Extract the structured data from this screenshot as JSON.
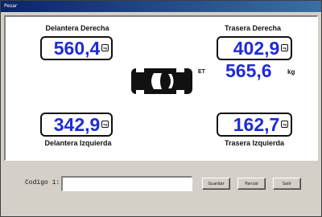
{
  "window": {
    "title": "Pesar"
  },
  "wheels": {
    "front_right": {
      "label": "Delantera Derecha",
      "value": "560,4",
      "unit": "kg"
    },
    "rear_right": {
      "label": "Trasera Derecha",
      "value": "402,9",
      "unit": "kg"
    },
    "front_left": {
      "label": "Delantera Izquierda",
      "value": "342,9",
      "unit": "kg"
    },
    "rear_left": {
      "label": "Trasera Izquierda",
      "value": "162,7",
      "unit": "kg"
    }
  },
  "total": {
    "label": "ET",
    "value": "565,6",
    "unit": "kg"
  },
  "form": {
    "code_label": "Codigo 1:",
    "code_value": ""
  },
  "buttons": {
    "save": "Guardar",
    "partial": "Parcial",
    "exit": "Salir"
  },
  "icons": {
    "car": "car-top-view-icon"
  },
  "colors": {
    "value_blue": "#1f2bd6",
    "title_bar": "#0a246a"
  }
}
